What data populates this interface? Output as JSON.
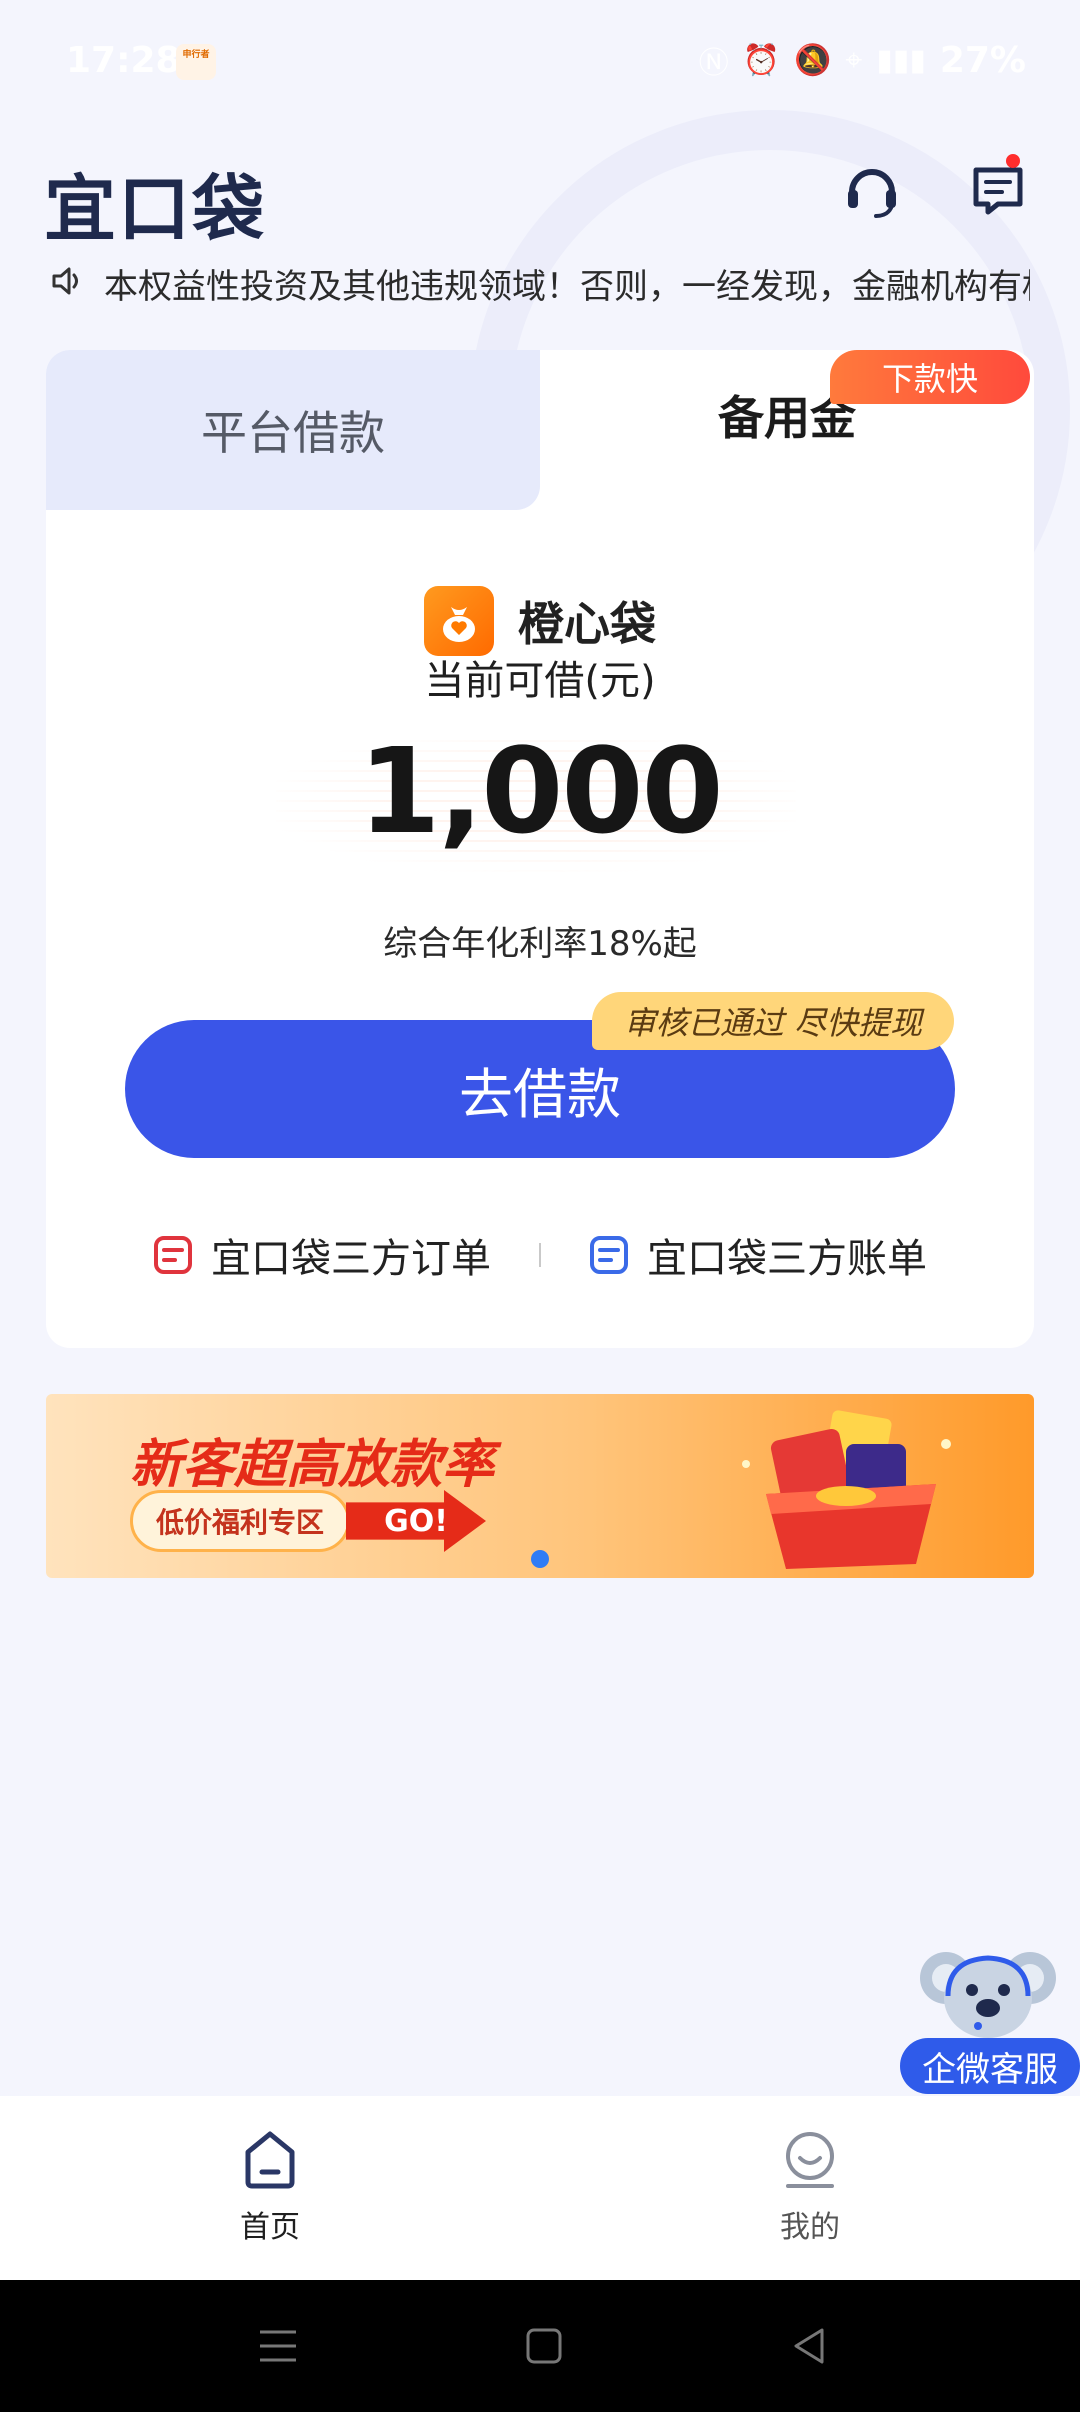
{
  "status_bar": {
    "time": "17:28",
    "app_badge": "申行者",
    "battery": "27%",
    "network": "5G"
  },
  "header": {
    "logo": "宜口袋"
  },
  "notice": {
    "text": "本权益性投资及其他违规领域！否则，一经发现，金融机构有权"
  },
  "tabs": {
    "left": "平台借款",
    "right": "备用金",
    "right_badge": "下款快"
  },
  "loan": {
    "brand": "橙心袋",
    "available_label": "当前可借(元)",
    "amount": "1,000",
    "rate": "综合年化利率18%起",
    "button": "去借款",
    "approved_badge": "审核已通过 尽快提现"
  },
  "links": {
    "orders": "宜口袋三方订单",
    "bills": "宜口袋三方账单"
  },
  "banner": {
    "title": "新客超高放款率",
    "pill": "低价福利专区",
    "go": "GO!"
  },
  "customer_service": {
    "label": "企微客服"
  },
  "bottom_nav": {
    "home": "首页",
    "me": "我的"
  },
  "colors": {
    "primary": "#3a55e8",
    "tab_inactive_bg": "#e6eafb",
    "badge_fast": "#ff5a3c",
    "approved_badge": "#ffd67a",
    "brand_orange": "#ff7a00"
  }
}
